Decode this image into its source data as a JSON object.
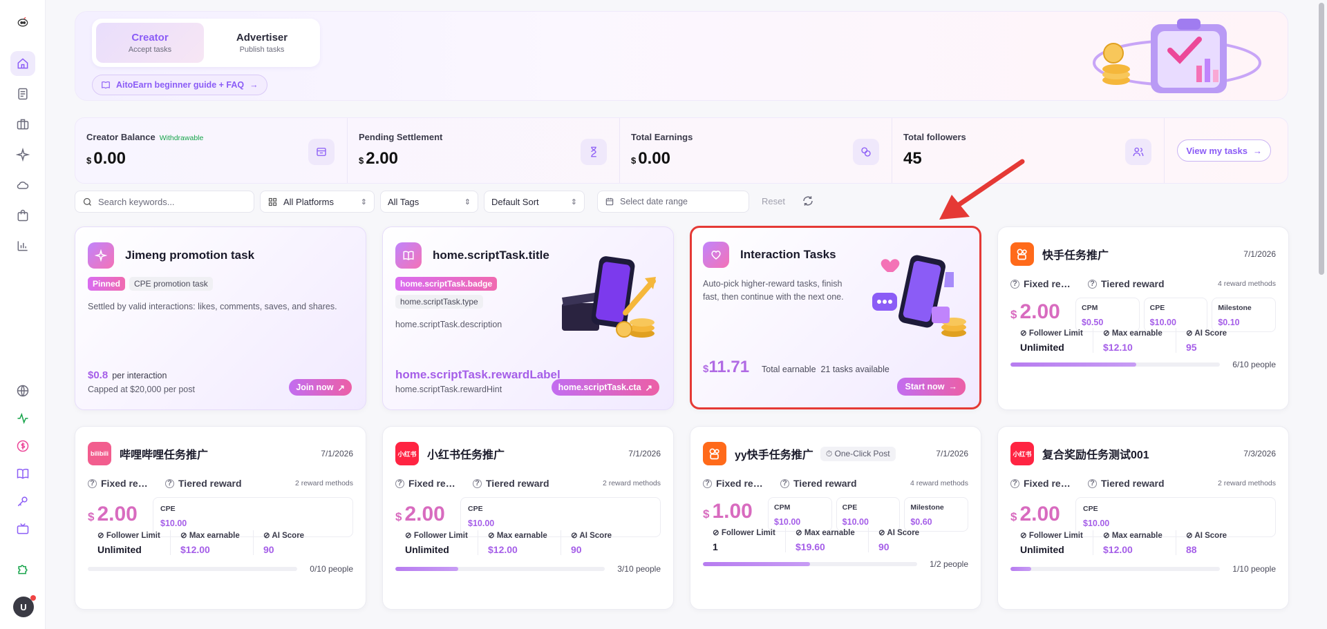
{
  "banner": {
    "creator": {
      "title": "Creator",
      "sub": "Accept tasks"
    },
    "advertiser": {
      "title": "Advertiser",
      "sub": "Publish tasks"
    },
    "guide": "AitoEarn beginner guide + FAQ"
  },
  "stats": [
    {
      "label": "Creator Balance",
      "extra": "Withdrawable",
      "currency": "$",
      "value": "0.00"
    },
    {
      "label": "Pending Settlement",
      "extra": "",
      "currency": "$",
      "value": "2.00"
    },
    {
      "label": "Total Earnings",
      "extra": "",
      "currency": "$",
      "value": "0.00"
    },
    {
      "label": "Total followers",
      "extra": "",
      "currency": "",
      "value": "45"
    }
  ],
  "view_tasks": "View my tasks",
  "filters": {
    "search_placeholder": "Search keywords...",
    "platforms": "All Platforms",
    "tags": "All Tags",
    "sort": "Default Sort",
    "date_placeholder": "Select date range",
    "reset": "Reset"
  },
  "feature_cards": {
    "jimeng": {
      "title": "Jimeng promotion task",
      "tags": [
        "Pinned",
        "CPE promotion task"
      ],
      "description": "Settled by valid interactions: likes, comments, saves, and shares.",
      "reward": "$0.8",
      "reward_unit": "per interaction",
      "hint": "Capped at $20,000 per post",
      "cta": "Join now"
    },
    "script": {
      "title": "home.scriptTask.title",
      "badge": "home.scriptTask.badge",
      "type": "home.scriptTask.type",
      "description": "home.scriptTask.description",
      "reward": "home.scriptTask.rewardLabel",
      "hint": "home.scriptTask.rewardHint",
      "cta": "home.scriptTask.cta"
    },
    "interaction": {
      "title": "Interaction Tasks",
      "description": "Auto-pick higher-reward tasks, finish fast, then continue with the next one.",
      "currency": "$",
      "amount": "11.71",
      "amount_label": "Total earnable",
      "available": "21 tasks available",
      "cta": "Start now"
    }
  },
  "labels": {
    "fixed": "Fixed reward",
    "tiered": "Tiered reward",
    "follower_limit": "Follower Limit",
    "max_earnable": "Max earnable",
    "ai_score": "AI Score"
  },
  "tasks": [
    {
      "title": "快手任务推广",
      "date": "7/1/2026",
      "methods": "4 reward methods",
      "currency": "$",
      "price": "2.00",
      "tiers": [
        {
          "name": "CPM",
          "value": "$0.50"
        },
        {
          "name": "CPE",
          "value": "$10.00"
        },
        {
          "name": "Milestone",
          "value": "$0.10"
        }
      ],
      "follower_limit": "Unlimited",
      "max_earnable": "$12.10",
      "ai_score": "95",
      "progress": 0.6,
      "people": "6/10 people",
      "platform": "kuaishou"
    },
    {
      "title": "哔哩哔哩任务推广",
      "date": "7/1/2026",
      "methods": "2 reward methods",
      "currency": "$",
      "price": "2.00",
      "tiers": [
        {
          "name": "CPE",
          "value": "$10.00"
        }
      ],
      "follower_limit": "Unlimited",
      "max_earnable": "$12.00",
      "ai_score": "90",
      "progress": 0,
      "people": "0/10 people",
      "platform": "bilibili"
    },
    {
      "title": "小红书任务推广",
      "date": "7/1/2026",
      "methods": "2 reward methods",
      "currency": "$",
      "price": "2.00",
      "tiers": [
        {
          "name": "CPE",
          "value": "$10.00"
        }
      ],
      "follower_limit": "Unlimited",
      "max_earnable": "$12.00",
      "ai_score": "90",
      "progress": 0.3,
      "people": "3/10 people",
      "platform": "xiaohongshu"
    },
    {
      "title": "yy快手任务推广",
      "badge": "One-Click Post",
      "date": "7/1/2026",
      "methods": "4 reward methods",
      "currency": "$",
      "price": "1.00",
      "tiers": [
        {
          "name": "CPM",
          "value": "$10.00"
        },
        {
          "name": "CPE",
          "value": "$10.00"
        },
        {
          "name": "Milestone",
          "value": "$0.60"
        }
      ],
      "follower_limit": "1",
      "max_earnable": "$19.60",
      "ai_score": "90",
      "progress": 0.5,
      "people": "1/2 people",
      "platform": "kuaishou"
    },
    {
      "title": "复合奖励任务测试001",
      "date": "7/3/2026",
      "methods": "2 reward methods",
      "currency": "$",
      "price": "2.00",
      "tiers": [
        {
          "name": "CPE",
          "value": "$10.00"
        }
      ],
      "follower_limit": "Unlimited",
      "max_earnable": "$12.00",
      "ai_score": "88",
      "progress": 0.1,
      "people": "1/10 people",
      "platform": "xiaohongshu"
    }
  ],
  "platform_labels": {
    "bilibili": "bilibili",
    "xiaohongshu": "小红书"
  },
  "colors": {
    "accent": "#8b5cf6",
    "pink": "#ec5fa6",
    "kuaishou": "#ff6a1a",
    "bilibili": "#f25d8e",
    "xiaohongshu": "#ff2442",
    "highlight": "#e53935"
  },
  "avatar": "U"
}
